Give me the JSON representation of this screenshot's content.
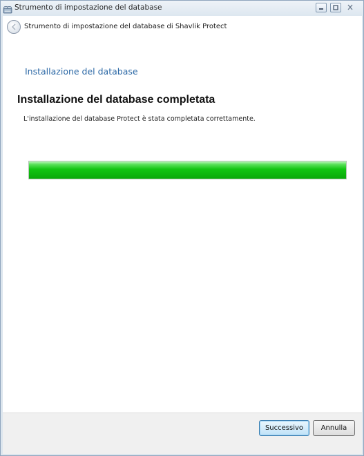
{
  "window": {
    "title": "Strumento di impostazione del database"
  },
  "header": {
    "title": "Strumento di impostazione del database di Shavlik Protect"
  },
  "page": {
    "section_title": "Installazione del database",
    "heading": "Installazione del database completata",
    "description": "L'installazione del database Protect è stata completata correttamente.",
    "progress_fraction": 1.0
  },
  "buttons": {
    "next": "Successivo",
    "cancel": "Annulla"
  },
  "colors": {
    "accent_text": "#2a67a5",
    "progress": "#12c512"
  },
  "icons": {
    "app": "database-setup-icon",
    "back": "back-arrow-icon",
    "minimize": "minimize-icon",
    "maximize": "maximize-icon",
    "close": "close-icon"
  }
}
